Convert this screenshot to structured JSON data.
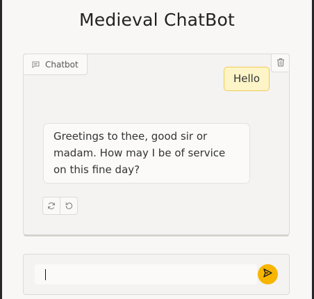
{
  "app": {
    "title": "Medieval ChatBot"
  },
  "chatbot": {
    "label": "Chatbot",
    "label_icon": "chat-bubble-icon",
    "clear_icon": "trash-icon",
    "messages": [
      {
        "role": "user",
        "text": "Hello"
      },
      {
        "role": "bot",
        "text": "Greetings to thee, good sir or madam. How may I be of service on this fine day?"
      }
    ],
    "bot_actions": [
      {
        "icon": "retry-icon"
      },
      {
        "icon": "undo-icon"
      }
    ]
  },
  "input": {
    "value": "",
    "placeholder": "",
    "send_icon": "send-icon"
  },
  "colors": {
    "accent": "#f7b500",
    "user_bubble_bg": "#fdf4c8",
    "user_bubble_border": "#f0cc56"
  }
}
